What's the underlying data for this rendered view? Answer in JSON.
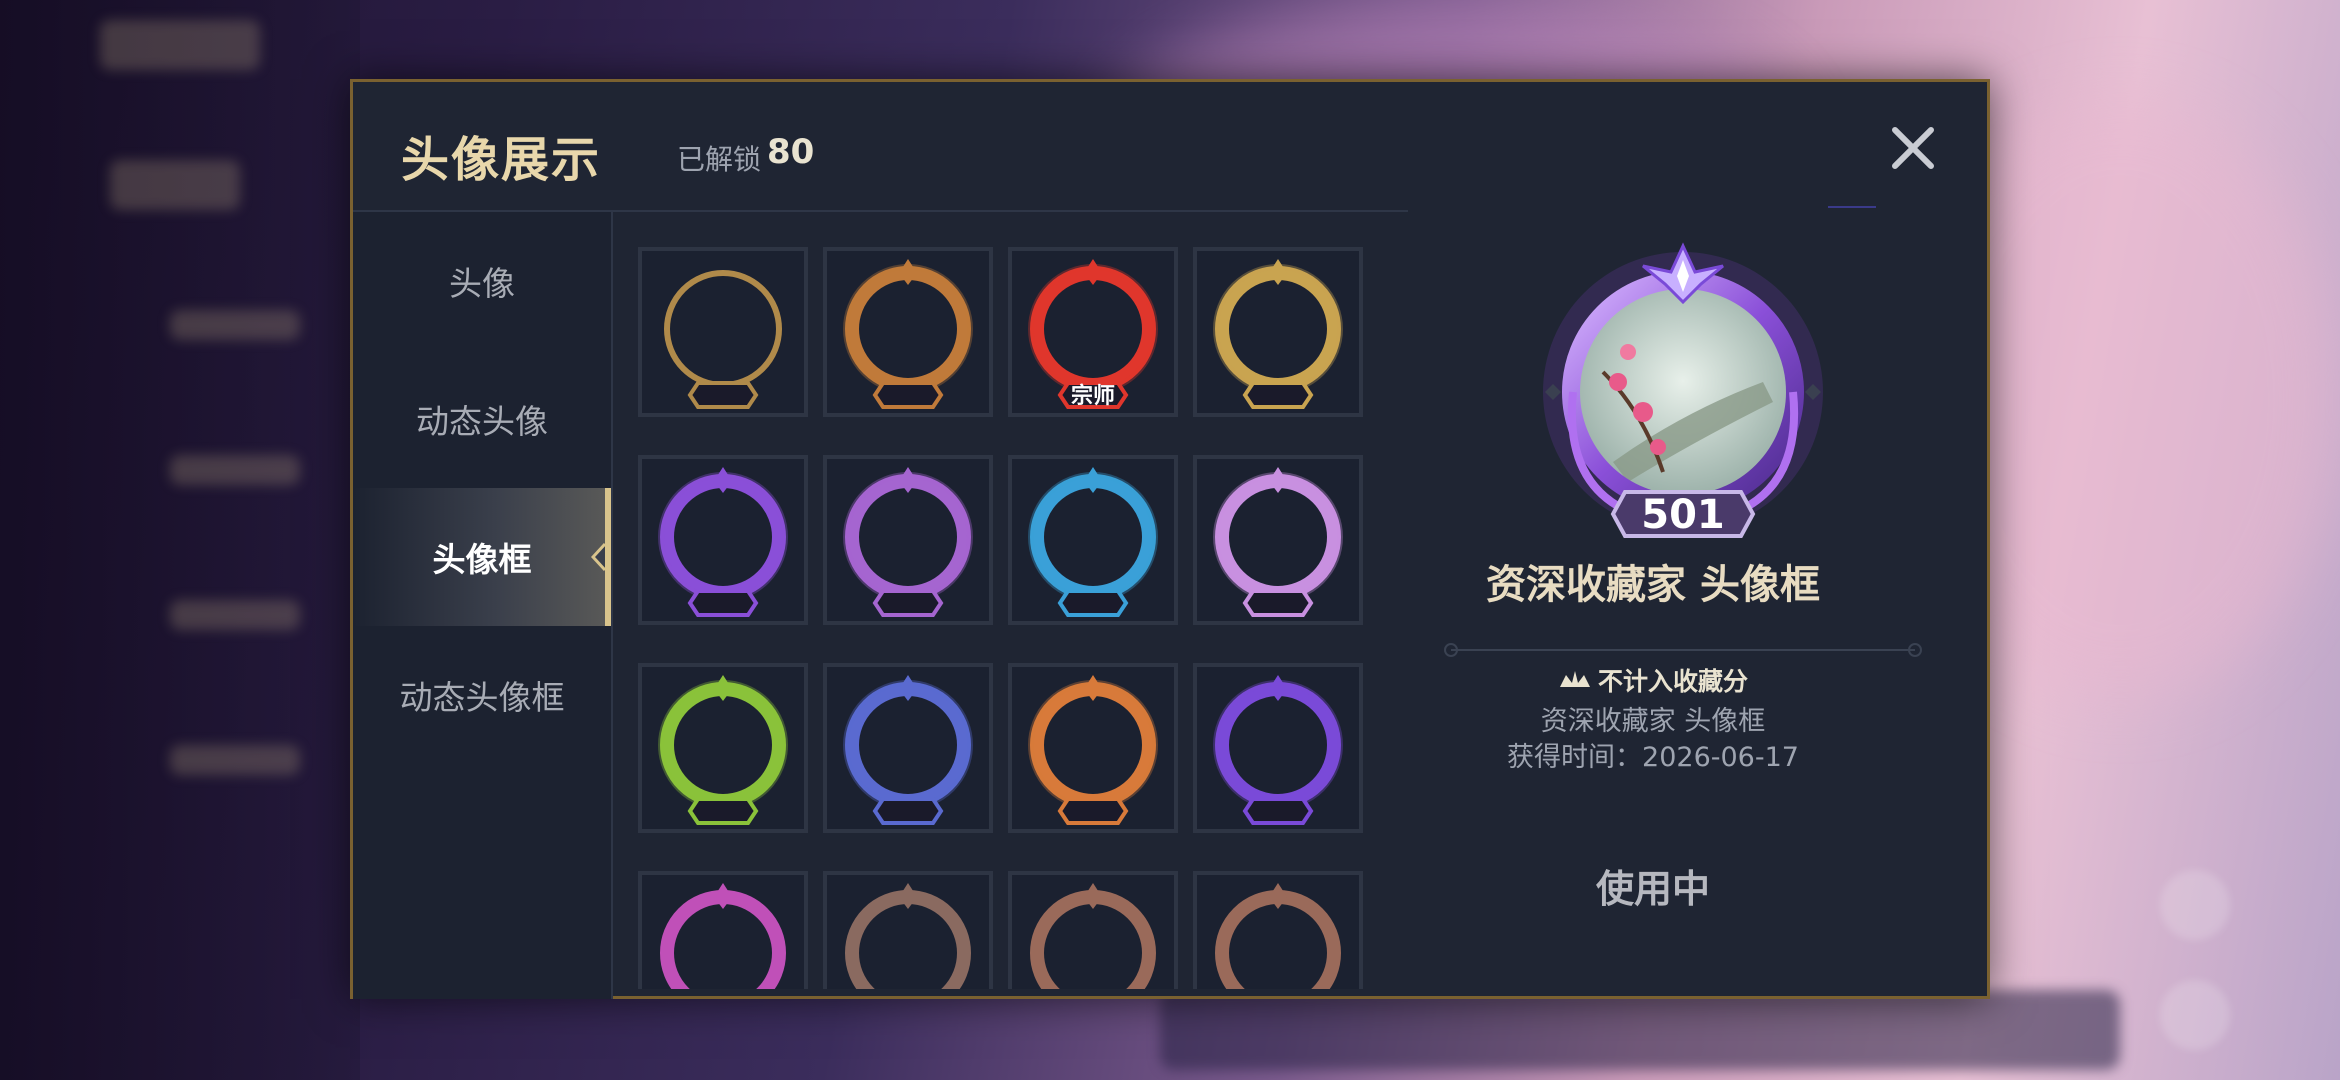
{
  "modal": {
    "title": "头像展示",
    "unlock_label": "已解锁",
    "unlock_count": "80"
  },
  "sidebar": {
    "items": [
      {
        "label": "头像",
        "active": false
      },
      {
        "label": "动态头像",
        "active": false
      },
      {
        "label": "头像框",
        "active": true
      },
      {
        "label": "动态头像框",
        "active": false
      }
    ]
  },
  "frames": [
    {
      "name": "plain-gold-frame",
      "color": "#b08a4a",
      "badge": ""
    },
    {
      "name": "bronze-ornate-frame",
      "color": "#c07a3a",
      "badge": ""
    },
    {
      "name": "red-grandmaster-frame",
      "color": "#e0362c",
      "badge": "宗师"
    },
    {
      "name": "gold-bird-frame",
      "color": "#c9a450",
      "badge": ""
    },
    {
      "name": "purple-dragon-frame",
      "color": "#8a4fd8",
      "badge": ""
    },
    {
      "name": "rainbow-ornate-frame",
      "color": "#a565d0",
      "badge": ""
    },
    {
      "name": "blue-lotus-frame",
      "color": "#3aa0d8",
      "badge": ""
    },
    {
      "name": "lilac-heart-frame",
      "color": "#c890e0",
      "badge": ""
    },
    {
      "name": "green-frog-frame",
      "color": "#8ac23a",
      "badge": ""
    },
    {
      "name": "blue-gold-wing-frame",
      "color": "#5a6ad0",
      "badge": ""
    },
    {
      "name": "autumn-flower-frame",
      "color": "#d87a3a",
      "badge": ""
    },
    {
      "name": "purple-key-frame",
      "color": "#7a4ad8",
      "badge": ""
    },
    {
      "name": "pink-flower-frame",
      "color": "#c050b8",
      "badge": ""
    },
    {
      "name": "bronze-plain-frame-a",
      "color": "#8a6a60",
      "badge": ""
    },
    {
      "name": "bronze-green-gem-frame",
      "color": "#9a6a5a",
      "badge": ""
    },
    {
      "name": "bronze-green-gem-frame-b",
      "color": "#9a6a5a",
      "badge": ""
    }
  ],
  "detail": {
    "badge_number": "501",
    "name": "资深收藏家  头像框",
    "no_score": "不计入收藏分",
    "desc_name": "资深收藏家  头像框",
    "acquired": "获得时间：2026-06-17",
    "status": "使用中",
    "badge_color": "#9a6ad8"
  }
}
